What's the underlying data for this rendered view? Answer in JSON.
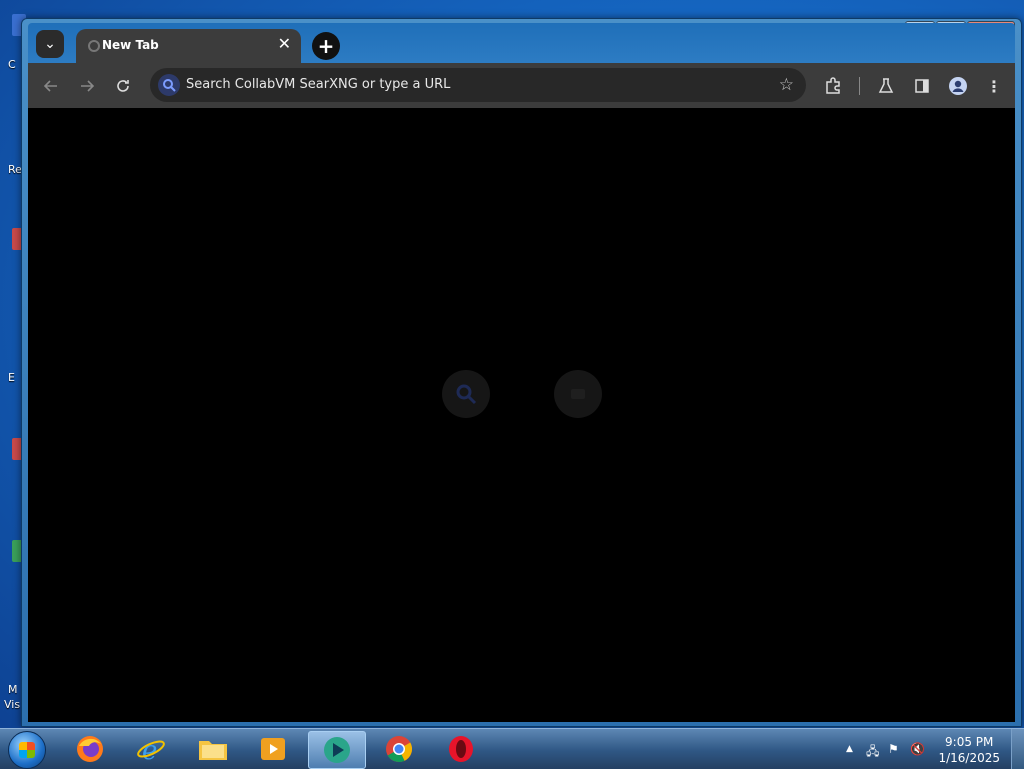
{
  "desktop": {
    "labels": [
      "C",
      "Re",
      "E",
      "M",
      "Vis"
    ]
  },
  "browser": {
    "tab_title": "New Tab",
    "tab_close": "✕",
    "new_tab": "+",
    "omnibox_placeholder": "Search CollabVM SearXNG or type a URL",
    "window_controls": {
      "minimize": "—",
      "maximize": "▢",
      "close": "✕"
    }
  },
  "content": {
    "shortcuts": [
      "",
      ""
    ]
  },
  "taskbar": {
    "time": "9:05 PM",
    "date": "1/16/2025",
    "apps": [
      "firefox",
      "internet-explorer",
      "file-explorer",
      "media-player",
      "collabvm",
      "chrome",
      "opera"
    ]
  },
  "colors": {
    "tab_bg": "#3c3c3c",
    "toolbar_bg": "#3c3c3c",
    "omnibox_bg": "#282828",
    "content_bg": "#000000"
  }
}
